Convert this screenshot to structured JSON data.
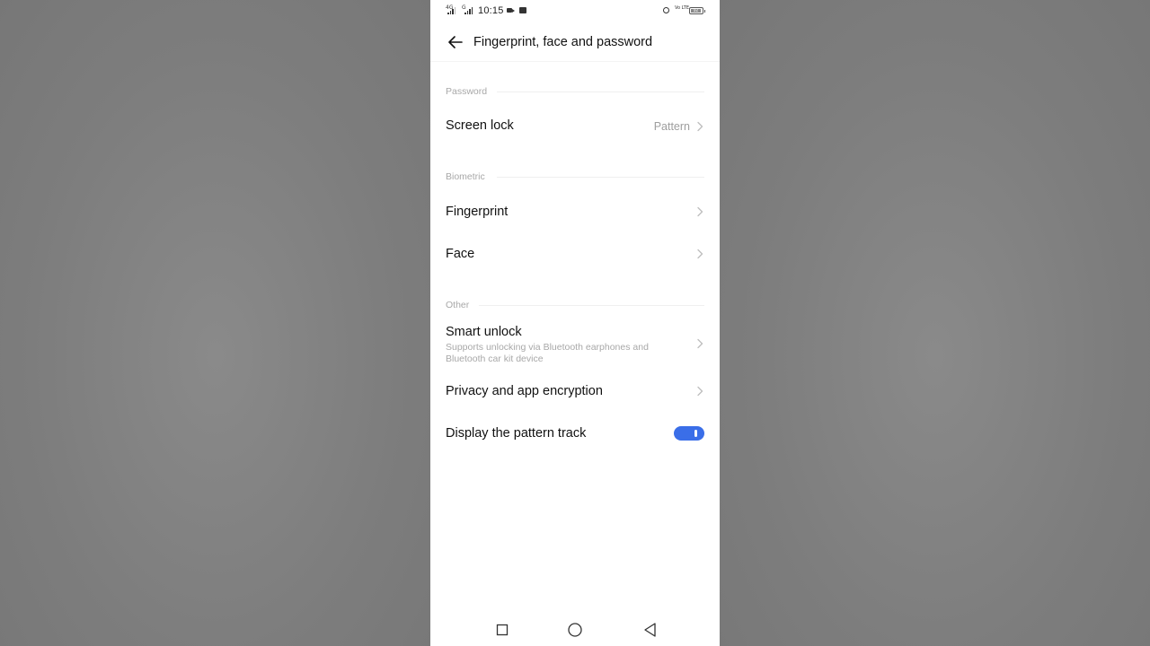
{
  "status_bar": {
    "network_1": "4G",
    "network_2": "G",
    "time": "10:15",
    "volte": "Vo LTE",
    "battery": "92",
    "icons": [
      "signal-icon",
      "video-icon",
      "mail-icon",
      "alarm-icon",
      "battery-icon"
    ]
  },
  "header": {
    "title": "Fingerprint, face and password",
    "back_icon": "arrow-left-icon"
  },
  "sections": {
    "password": {
      "label": "Password",
      "screen_lock": {
        "title": "Screen lock",
        "value": "Pattern"
      }
    },
    "biometric": {
      "label": "Biometric",
      "fingerprint": {
        "title": "Fingerprint"
      },
      "face": {
        "title": "Face"
      }
    },
    "other": {
      "label": "Other",
      "smart_unlock": {
        "title": "Smart unlock",
        "subtitle": "Supports unlocking via Bluetooth earphones and Bluetooth car kit device"
      },
      "privacy": {
        "title": "Privacy and app encryption"
      },
      "pattern_track": {
        "title": "Display the pattern track",
        "enabled": true
      }
    }
  },
  "colors": {
    "accent": "#3a6ee8",
    "text_primary": "#111111",
    "text_secondary": "#a8a8a8"
  },
  "nav_bar": {
    "icons": [
      "recents-square-icon",
      "home-circle-icon",
      "back-triangle-icon"
    ]
  }
}
